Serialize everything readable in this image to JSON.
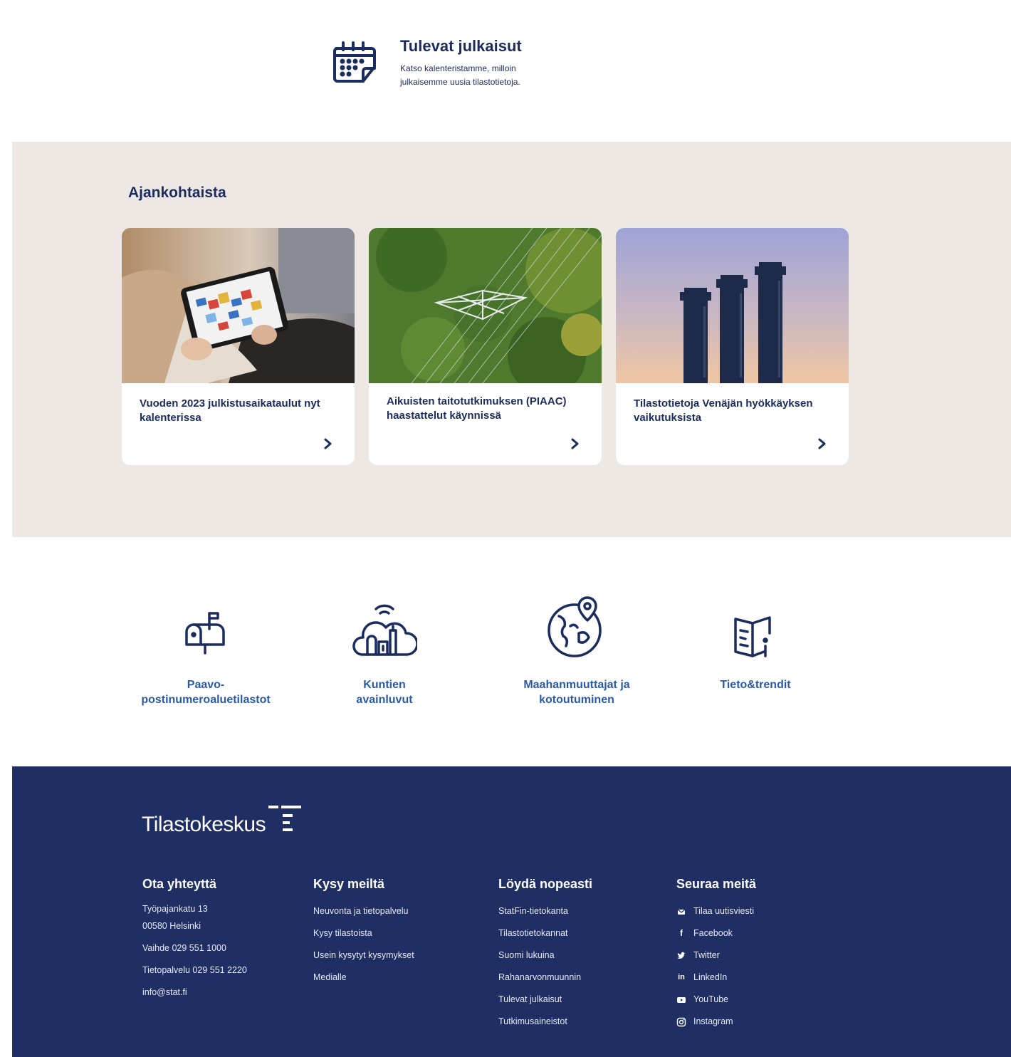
{
  "promo": {
    "title": "Tulevat julkaisut",
    "description": "Katso kalenteristamme, milloin julkaisemme uusia tilastotietoja.",
    "icon": "calendar-icon"
  },
  "news": {
    "heading": "Ajankohtaista",
    "cards": [
      {
        "title": "Vuoden 2023 julkistusaikataulut nyt kalenterissa",
        "image": "tablet-calendar-photo"
      },
      {
        "title": "Aikuisten taitotutkimuksen (PIAAC) haastattelut käynnissä",
        "image": "power-pylon-aerial-photo"
      },
      {
        "title": "Tilastotietoja Venäjän hyökkäyksen vaikutuksista",
        "image": "chimneys-photo"
      }
    ]
  },
  "shortcuts": [
    {
      "label": "Paavo-postinumeroaluetilastot",
      "icon": "mailbox-icon"
    },
    {
      "label": "Kuntien avainluvut",
      "icon": "city-cloud-icon"
    },
    {
      "label": "Maahanmuuttajat ja kotoutuminen",
      "icon": "globe-pin-icon"
    },
    {
      "label": "Tieto&trendit",
      "icon": "book-info-icon"
    }
  ],
  "footer": {
    "logo_text": "Tilastokeskus",
    "contact": {
      "heading": "Ota yhteyttä",
      "street": "Työpajankatu 13",
      "postal": "00580 Helsinki",
      "phone_switch": "Vaihde  029 551 1000",
      "phone_info": "Tietopalvelu   029 551 2220",
      "email": "info@stat.fi"
    },
    "ask": {
      "heading": "Kysy meiltä",
      "links": [
        "Neuvonta ja tietopalvelu",
        "Kysy tilastoista",
        "Usein kysytyt kysymykset",
        "Medialle"
      ]
    },
    "find": {
      "heading": "Löydä nopeasti",
      "links": [
        "StatFin-tietokanta",
        "Tilastotietokannat",
        "Suomi lukuina",
        "Rahanarvonmuunnin",
        "Tulevat julkaisut",
        "Tutkimusaineistot"
      ]
    },
    "follow": {
      "heading": "Seuraa meitä",
      "links": [
        {
          "label": "Tilaa uutisviesti",
          "icon": "mail-icon"
        },
        {
          "label": "Facebook",
          "icon": "facebook-icon"
        },
        {
          "label": "Twitter",
          "icon": "twitter-icon"
        },
        {
          "label": "LinkedIn",
          "icon": "linkedin-icon"
        },
        {
          "label": "YouTube",
          "icon": "youtube-icon"
        },
        {
          "label": "Instagram",
          "icon": "instagram-icon"
        }
      ]
    }
  },
  "colors": {
    "navy": "#1b2c5e",
    "link_blue": "#2a5aa8",
    "news_bg": "#ede8e4",
    "footer_bg": "#1f2f63"
  }
}
